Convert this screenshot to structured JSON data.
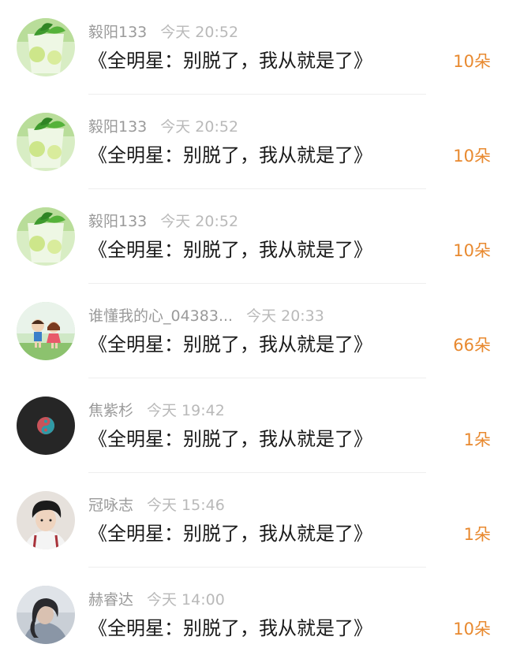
{
  "entries": [
    {
      "name": "毅阳133",
      "time": "今天 20:52",
      "title": "《全明星：别脱了，我从就是了》",
      "count": "10朵",
      "avatar": "mojito-drink-avatar"
    },
    {
      "name": "毅阳133",
      "time": "今天 20:52",
      "title": "《全明星：别脱了，我从就是了》",
      "count": "10朵",
      "avatar": "mojito-drink-avatar"
    },
    {
      "name": "毅阳133",
      "time": "今天 20:52",
      "title": "《全明星：别脱了，我从就是了》",
      "count": "10朵",
      "avatar": "mojito-drink-avatar"
    },
    {
      "name": "谁懂我的心_04383...",
      "time": "今天 20:33",
      "title": "《全明星：别脱了，我从就是了》",
      "count": "66朵",
      "avatar": "cartoon-kids-avatar"
    },
    {
      "name": "焦紫杉",
      "time": "今天 19:42",
      "title": "《全明星：别脱了，我从就是了》",
      "count": "1朵",
      "avatar": "dark-emblem-avatar"
    },
    {
      "name": "冠咏志",
      "time": "今天 15:46",
      "title": "《全明星：别脱了，我从就是了》",
      "count": "1朵",
      "avatar": "boy-photo-avatar"
    },
    {
      "name": "赫睿达",
      "time": "今天 14:00",
      "title": "《全明星：别脱了，我从就是了》",
      "count": "10朵",
      "avatar": "woman-photo-avatar"
    }
  ],
  "colors": {
    "count": "#e8892f",
    "name": "#9a9a9a",
    "time": "#b9b9b9",
    "title": "#1a1a1a",
    "divider": "#eeeeee"
  }
}
